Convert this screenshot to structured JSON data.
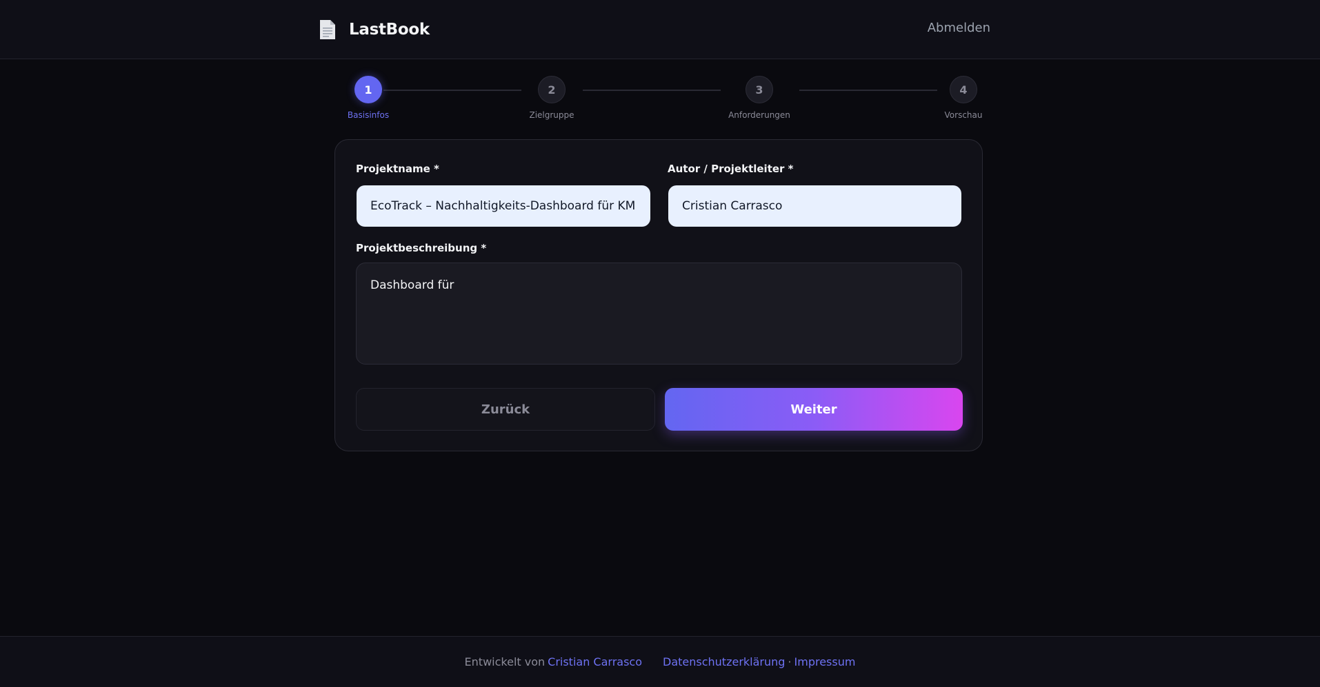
{
  "header": {
    "brand": "LastBook",
    "logout_label": "Abmelden"
  },
  "stepper": {
    "steps": [
      {
        "number": "1",
        "label": "Basisinfos",
        "active": true
      },
      {
        "number": "2",
        "label": "Zielgruppe",
        "active": false
      },
      {
        "number": "3",
        "label": "Anforderungen",
        "active": false
      },
      {
        "number": "4",
        "label": "Vorschau",
        "active": false
      }
    ]
  },
  "form": {
    "project_name_label": "Projektname *",
    "project_name_value": "EcoTrack – Nachhaltigkeits-Dashboard für KM",
    "author_label": "Autor / Projektleiter *",
    "author_value": "Cristian Carrasco",
    "description_label": "Projektbeschreibung *",
    "description_value": "Dashboard für",
    "back_label": "Zurück",
    "next_label": "Weiter"
  },
  "footer": {
    "developed_by": "Entwickelt von",
    "author_link": "Cristian Carrasco",
    "privacy_link": "Datenschutzerklärung",
    "separator": "·",
    "imprint_link": "Impressum"
  },
  "colors": {
    "accent": "#6366f1",
    "gradient_end": "#d946ef",
    "background": "#0a0a0f",
    "input_bg": "#e8f0fe"
  },
  "icons": {
    "brand": "document-icon"
  }
}
